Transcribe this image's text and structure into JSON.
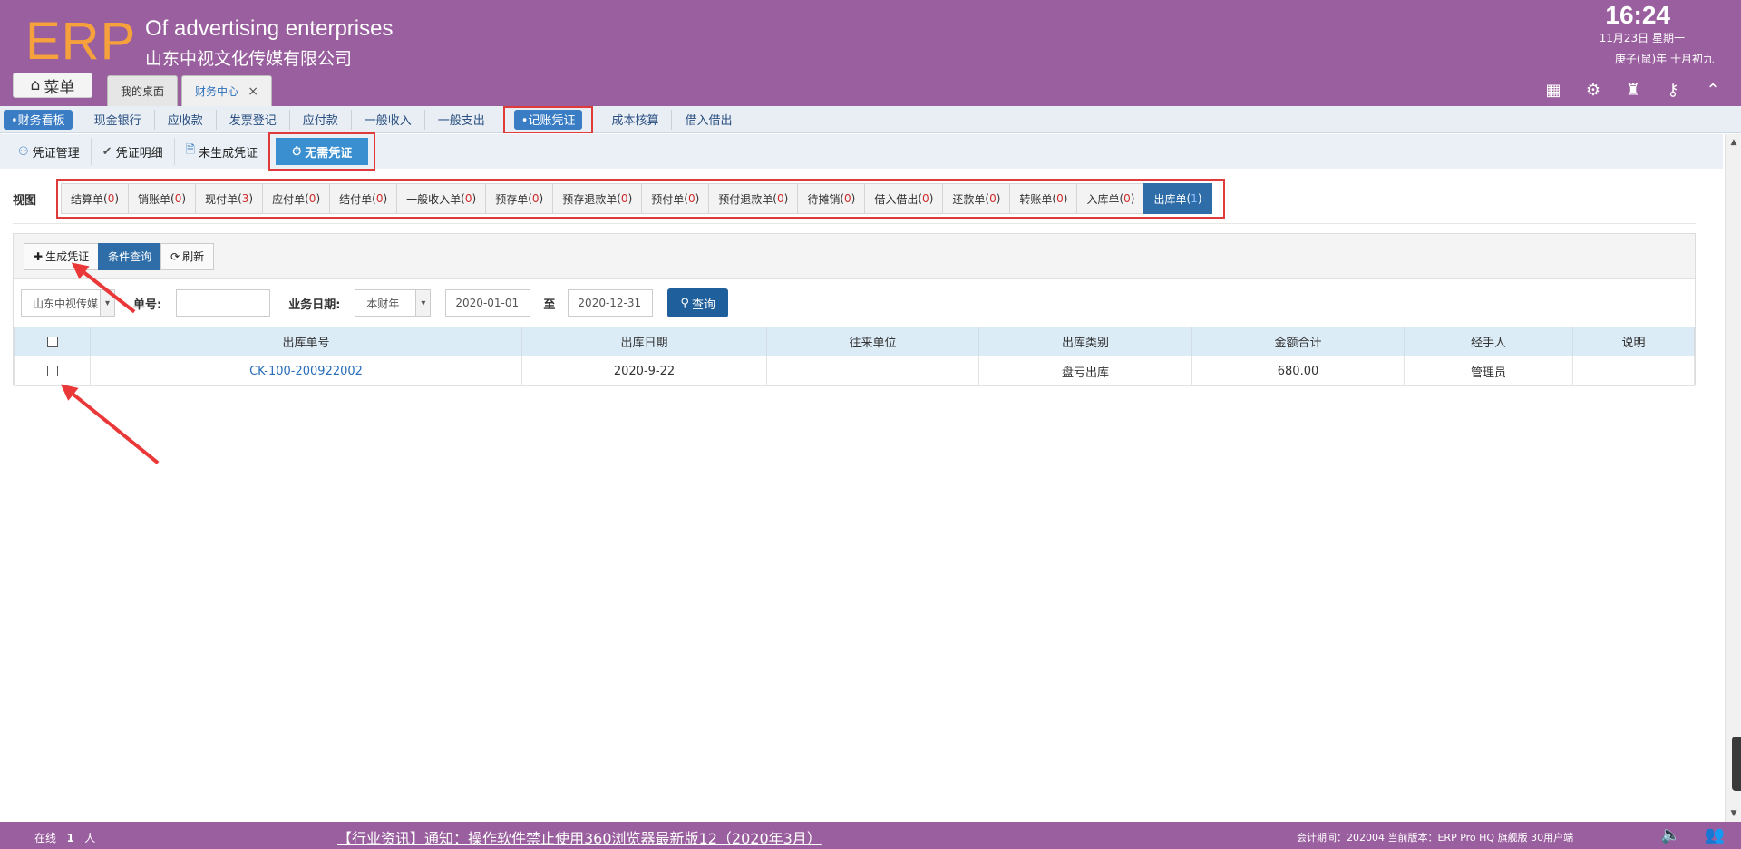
{
  "header": {
    "logo": "ERP",
    "tagline": "Of advertising enterprises",
    "company": "山东中视文化传媒有限公司",
    "time": "16:24",
    "date": "11月23日 星期一",
    "lunar": "庚子(鼠)年 十月初九",
    "menu_label": "菜单",
    "tabs": [
      {
        "label": "我的桌面"
      },
      {
        "label": "财务中心",
        "close": "×"
      }
    ]
  },
  "module_nav": {
    "items": [
      "•财务看板",
      "现金银行",
      "应收款",
      "发票登记",
      "应付款",
      "一般收入",
      "一般支出",
      "•记账凭证",
      "成本核算",
      "借入借出"
    ]
  },
  "sub_nav": {
    "items": [
      "凭证管理",
      "凭证明细",
      "未生成凭证",
      "无需凭证"
    ]
  },
  "view": {
    "label": "视图",
    "items": [
      {
        "name": "结算单",
        "count": "0"
      },
      {
        "name": "销账单",
        "count": "0"
      },
      {
        "name": "现付单",
        "count": "3"
      },
      {
        "name": "应付单",
        "count": "0"
      },
      {
        "name": "结付单",
        "count": "0"
      },
      {
        "name": "一般收入单",
        "count": "0"
      },
      {
        "name": "预存单",
        "count": "0"
      },
      {
        "name": "预存退款单",
        "count": "0"
      },
      {
        "name": "预付单",
        "count": "0"
      },
      {
        "name": "预付退款单",
        "count": "0"
      },
      {
        "name": "待摊销",
        "count": "0"
      },
      {
        "name": "借入借出",
        "count": "0"
      },
      {
        "name": "还款单",
        "count": "0"
      },
      {
        "name": "转账单",
        "count": "0"
      },
      {
        "name": "入库单",
        "count": "0"
      },
      {
        "name": "出库单",
        "count": "1"
      }
    ]
  },
  "toolbar": {
    "generate": "生成凭证",
    "query": "条件查询",
    "refresh": "刷新"
  },
  "filters": {
    "company": "山东中视传媒",
    "no_label": "单号:",
    "no_value": "",
    "date_label": "业务日期:",
    "period": "本财年",
    "from": "2020-01-01",
    "to_label": "至",
    "to": "2020-12-31",
    "search": "查询"
  },
  "table": {
    "headers": [
      "出库单号",
      "出库日期",
      "往来单位",
      "出库类别",
      "金额合计",
      "经手人",
      "说明"
    ],
    "rows": [
      [
        "CK-100-200922002",
        "2020-9-22",
        "",
        "盘亏出库",
        "680.00",
        "管理员",
        ""
      ]
    ]
  },
  "footer": {
    "online_label": "在线",
    "online_count": "1",
    "online_unit": "人",
    "news": "【行业资讯】通知：操作软件禁止使用360浏览器最新版12（2020年3月）",
    "account": "会计期间：202004 当前版本：ERP Pro HQ 旗舰版 30用户端"
  },
  "colors": {
    "header": "#9a5f9e",
    "logo": "#f6a13b",
    "primary": "#2e6da8",
    "highlight": "#e03b3b"
  }
}
